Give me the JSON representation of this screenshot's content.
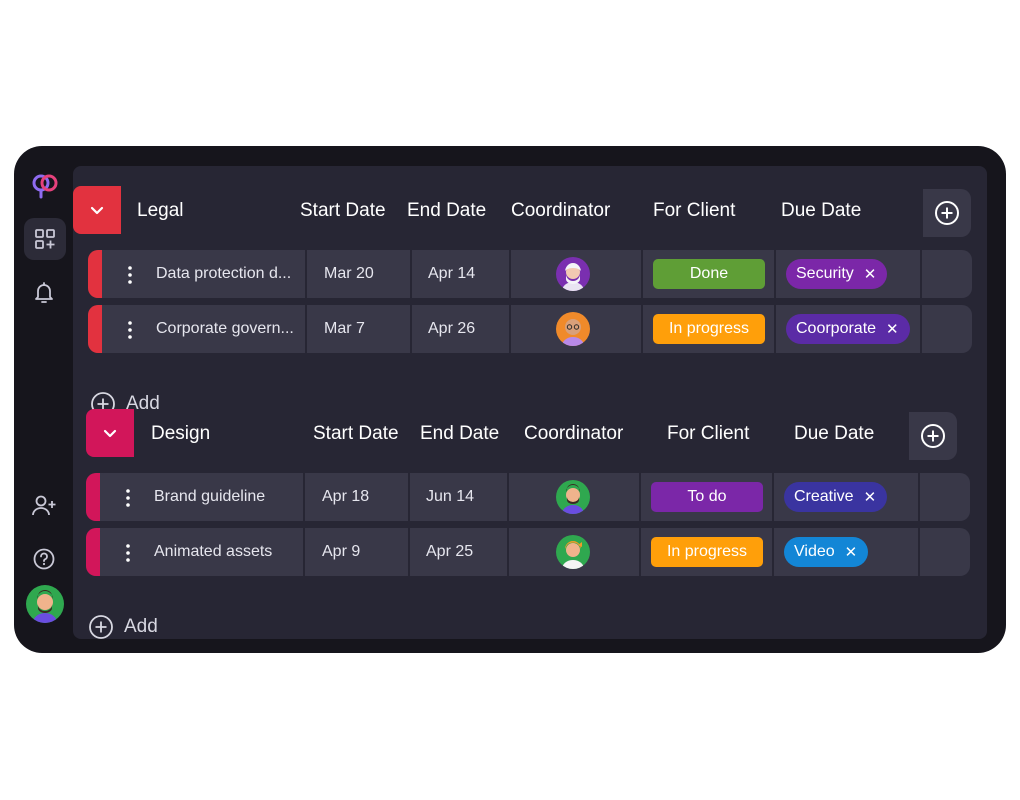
{
  "colors": {
    "app_bg": "#16151c",
    "panel_bg": "#272634",
    "row_bg": "#393848",
    "legal_accent": "#e2323f",
    "design_accent": "#d2165a",
    "done": "#5f9e36",
    "in_progress": "#ff9f0a",
    "todo": "#7b27a8"
  },
  "sidebar": {
    "icons": [
      "logo-icon",
      "dashboard-add-icon",
      "bell-icon",
      "add-user-icon",
      "help-icon"
    ]
  },
  "columns": [
    "Start Date",
    "End Date",
    "Coordinator",
    "For Client",
    "Due Date"
  ],
  "groups": [
    {
      "name": "Legal",
      "rows": [
        {
          "task": "Data protection d...",
          "start": "Mar 20",
          "end": "Apr 14",
          "status": "Done",
          "tag": "Security"
        },
        {
          "task": "Corporate govern...",
          "start": "Mar 7",
          "end": "Apr 26",
          "status": "In progress",
          "tag": "Coorporate"
        }
      ],
      "add_label": "Add"
    },
    {
      "name": "Design",
      "rows": [
        {
          "task": "Brand guideline",
          "start": "Apr 18",
          "end": "Jun 14",
          "status": "To do",
          "tag": "Creative"
        },
        {
          "task": "Animated assets",
          "start": "Apr 9",
          "end": "Apr 25",
          "status": "In progress",
          "tag": "Video"
        }
      ],
      "add_label": "Add"
    }
  ]
}
